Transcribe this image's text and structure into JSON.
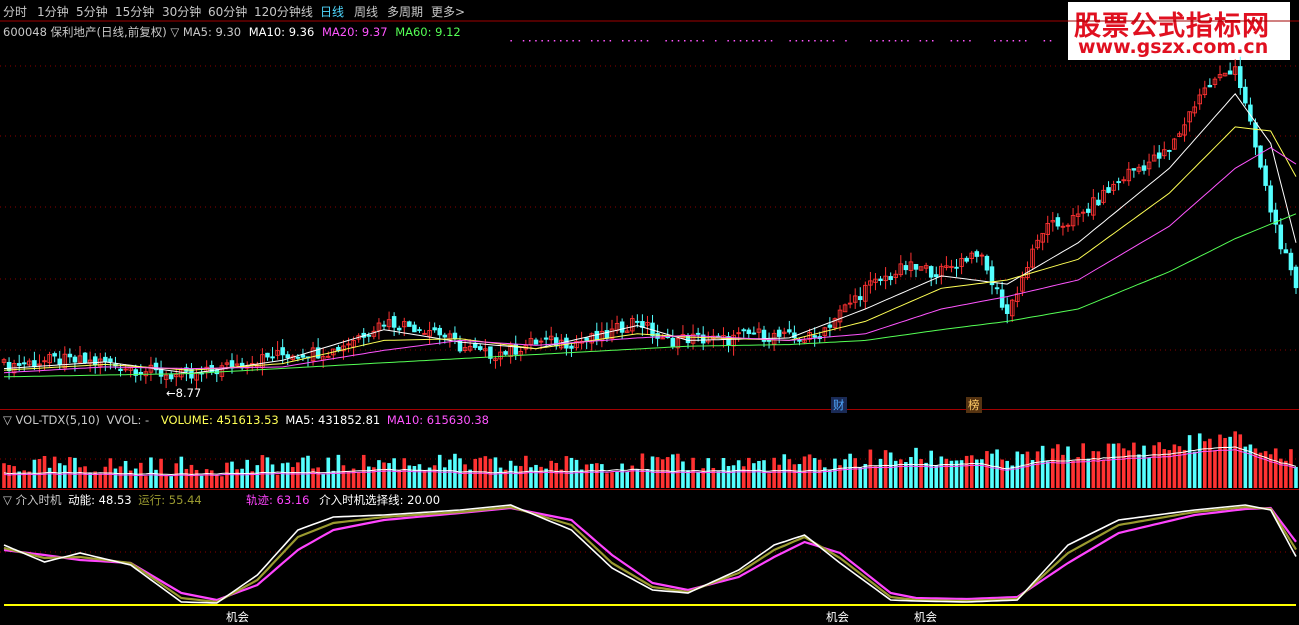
{
  "toolbar": {
    "items": [
      "分时",
      "1分钟",
      "5分钟",
      "15分钟",
      "30分钟",
      "60分钟",
      "120分钟线",
      "日线",
      "周线",
      "多周期",
      "更多>"
    ],
    "active": "日线"
  },
  "watermark": {
    "line1": "股票公式指标网",
    "line2": "www.gszx.com.cn"
  },
  "price_panel": {
    "stock": "600048 保利地产(日线,前复权)",
    "indicator": "▽ MA5: 9.30",
    "ma10": "MA10: 9.36",
    "ma20": "MA20: 9.37",
    "ma60": "MA60: 9.12",
    "low_label": "←8.77",
    "markers": [
      "财",
      "榜"
    ]
  },
  "volume_panel": {
    "title": "▽ VOL-TDX(5,10)",
    "vvol": "VVOL: -",
    "volume": "VOLUME: 451613.53",
    "ma5": "MA5: 431852.81",
    "ma10": "MA10: 615630.38"
  },
  "timing_panel": {
    "title": "▽ 介入时机",
    "power": "动能: 48.53",
    "run": "运行: 55.44",
    "track": "轨迹: 63.16",
    "select": "介入时机选择线: 20.00",
    "signals": [
      "机会",
      "机会",
      "机会"
    ]
  },
  "colors": {
    "up": "#ff3232",
    "down": "#54ffff",
    "ma5": "#ffffff",
    "ma10": "#ffff55",
    "ma20": "#ff55ff",
    "ma60": "#55ff55",
    "grid": "#8b0000",
    "power": "#ffffff",
    "run": "#9a9a30",
    "track": "#ff44ff",
    "select": "#ffff00"
  },
  "chart_data": [
    {
      "type": "candlestick",
      "title": "600048 保利地产(日线,前复权)",
      "close_path": [
        [
          0,
          8.92
        ],
        [
          10,
          8.98
        ],
        [
          20,
          8.95
        ],
        [
          30,
          8.83
        ],
        [
          37,
          8.77
        ],
        [
          45,
          8.92
        ],
        [
          55,
          9.05
        ],
        [
          65,
          9.1
        ],
        [
          75,
          9.45
        ],
        [
          80,
          9.4
        ],
        [
          85,
          9.35
        ],
        [
          90,
          9.15
        ],
        [
          95,
          9.05
        ],
        [
          100,
          9.1
        ],
        [
          105,
          9.2
        ],
        [
          112,
          9.2
        ],
        [
          118,
          9.25
        ],
        [
          125,
          9.48
        ],
        [
          130,
          9.2
        ],
        [
          135,
          9.25
        ],
        [
          142,
          9.22
        ],
        [
          148,
          9.3
        ],
        [
          155,
          9.25
        ],
        [
          160,
          9.25
        ],
        [
          170,
          9.85
        ],
        [
          178,
          10.1
        ],
        [
          185,
          10.05
        ],
        [
          192,
          10.3
        ],
        [
          198,
          9.55
        ],
        [
          205,
          10.55
        ],
        [
          212,
          10.7
        ],
        [
          222,
          11.25
        ],
        [
          230,
          11.5
        ],
        [
          236,
          12.2
        ],
        [
          243,
          12.55
        ],
        [
          250,
          10.8
        ],
        [
          255,
          9.8
        ]
      ],
      "ma_lines": {
        "MA5": [
          [
            0,
            8.88
          ],
          [
            20,
            8.96
          ],
          [
            37,
            8.82
          ],
          [
            55,
            8.98
          ],
          [
            75,
            9.35
          ],
          [
            90,
            9.2
          ],
          [
            105,
            9.12
          ],
          [
            125,
            9.4
          ],
          [
            135,
            9.22
          ],
          [
            155,
            9.25
          ],
          [
            170,
            9.6
          ],
          [
            185,
            10.0
          ],
          [
            198,
            9.9
          ],
          [
            212,
            10.4
          ],
          [
            230,
            11.3
          ],
          [
            243,
            12.2
          ],
          [
            250,
            11.6
          ],
          [
            255,
            10.4
          ]
        ],
        "MA10": [
          [
            0,
            8.86
          ],
          [
            20,
            8.93
          ],
          [
            37,
            8.86
          ],
          [
            55,
            8.94
          ],
          [
            75,
            9.22
          ],
          [
            90,
            9.24
          ],
          [
            105,
            9.12
          ],
          [
            125,
            9.3
          ],
          [
            135,
            9.26
          ],
          [
            155,
            9.22
          ],
          [
            170,
            9.45
          ],
          [
            185,
            9.85
          ],
          [
            198,
            9.95
          ],
          [
            212,
            10.2
          ],
          [
            230,
            11.0
          ],
          [
            243,
            11.8
          ],
          [
            250,
            11.75
          ],
          [
            255,
            11.2
          ]
        ],
        "MA20": [
          [
            0,
            8.83
          ],
          [
            20,
            8.9
          ],
          [
            37,
            8.88
          ],
          [
            55,
            8.9
          ],
          [
            75,
            9.1
          ],
          [
            90,
            9.22
          ],
          [
            105,
            9.16
          ],
          [
            125,
            9.25
          ],
          [
            135,
            9.28
          ],
          [
            155,
            9.22
          ],
          [
            170,
            9.3
          ],
          [
            185,
            9.6
          ],
          [
            198,
            9.75
          ],
          [
            212,
            9.95
          ],
          [
            230,
            10.6
          ],
          [
            243,
            11.3
          ],
          [
            250,
            11.55
          ],
          [
            255,
            11.35
          ]
        ],
        "MA60": [
          [
            0,
            8.78
          ],
          [
            37,
            8.82
          ],
          [
            75,
            8.95
          ],
          [
            105,
            9.05
          ],
          [
            135,
            9.15
          ],
          [
            155,
            9.17
          ],
          [
            170,
            9.22
          ],
          [
            185,
            9.35
          ],
          [
            198,
            9.45
          ],
          [
            212,
            9.6
          ],
          [
            230,
            10.05
          ],
          [
            243,
            10.45
          ],
          [
            255,
            10.75
          ]
        ]
      }
    },
    {
      "type": "bar",
      "title": "VOL-TDX(5,10)",
      "series": [
        {
          "name": "VOLUME",
          "value": 451613.53
        },
        {
          "name": "MA5",
          "value": 431852.81
        },
        {
          "name": "MA10",
          "value": 615630.38
        }
      ]
    },
    {
      "type": "line",
      "title": "介入时机",
      "series": [
        {
          "name": "动能",
          "last": 48.53,
          "points": [
            [
              0,
              60
            ],
            [
              8,
              43
            ],
            [
              15,
              52
            ],
            [
              25,
              40
            ],
            [
              35,
              3
            ],
            [
              42,
              2
            ],
            [
              50,
              30
            ],
            [
              58,
              75
            ],
            [
              65,
              88
            ],
            [
              75,
              90
            ],
            [
              90,
              95
            ],
            [
              100,
              100
            ],
            [
              112,
              75
            ],
            [
              120,
              37
            ],
            [
              128,
              15
            ],
            [
              135,
              12
            ],
            [
              145,
              35
            ],
            [
              152,
              60
            ],
            [
              158,
              70
            ],
            [
              165,
              42
            ],
            [
              175,
              5
            ],
            [
              180,
              4
            ],
            [
              190,
              3
            ],
            [
              200,
              5
            ],
            [
              210,
              60
            ],
            [
              220,
              85
            ],
            [
              235,
              95
            ],
            [
              245,
              100
            ],
            [
              250,
              95
            ],
            [
              255,
              48.53
            ]
          ]
        },
        {
          "name": "运行",
          "last": 55.44,
          "points": [
            [
              0,
              57
            ],
            [
              8,
              47
            ],
            [
              15,
              48
            ],
            [
              25,
              42
            ],
            [
              35,
              7
            ],
            [
              42,
              3
            ],
            [
              50,
              25
            ],
            [
              58,
              68
            ],
            [
              65,
              82
            ],
            [
              75,
              88
            ],
            [
              90,
              93
            ],
            [
              100,
              98
            ],
            [
              112,
              80
            ],
            [
              120,
              42
            ],
            [
              128,
              18
            ],
            [
              135,
              13
            ],
            [
              145,
              32
            ],
            [
              152,
              55
            ],
            [
              158,
              68
            ],
            [
              165,
              47
            ],
            [
              175,
              8
            ],
            [
              180,
              5
            ],
            [
              190,
              4
            ],
            [
              200,
              6
            ],
            [
              210,
              52
            ],
            [
              220,
              80
            ],
            [
              235,
              93
            ],
            [
              245,
              98
            ],
            [
              250,
              96
            ],
            [
              255,
              55.44
            ]
          ]
        },
        {
          "name": "轨迹",
          "last": 63.16,
          "points": [
            [
              0,
              55
            ],
            [
              8,
              50
            ],
            [
              15,
              45
            ],
            [
              25,
              42
            ],
            [
              35,
              12
            ],
            [
              42,
              5
            ],
            [
              50,
              20
            ],
            [
              58,
              55
            ],
            [
              65,
              75
            ],
            [
              75,
              85
            ],
            [
              90,
              92
            ],
            [
              100,
              97
            ],
            [
              112,
              85
            ],
            [
              120,
              50
            ],
            [
              128,
              22
            ],
            [
              135,
              15
            ],
            [
              145,
              28
            ],
            [
              152,
              48
            ],
            [
              158,
              63
            ],
            [
              165,
              52
            ],
            [
              175,
              12
            ],
            [
              180,
              7
            ],
            [
              190,
              6
            ],
            [
              200,
              8
            ],
            [
              210,
              42
            ],
            [
              220,
              72
            ],
            [
              235,
              90
            ],
            [
              245,
              96
            ],
            [
              250,
              97
            ],
            [
              255,
              63.16
            ]
          ]
        },
        {
          "name": "介入时机选择线",
          "last": 20.0
        }
      ]
    }
  ]
}
